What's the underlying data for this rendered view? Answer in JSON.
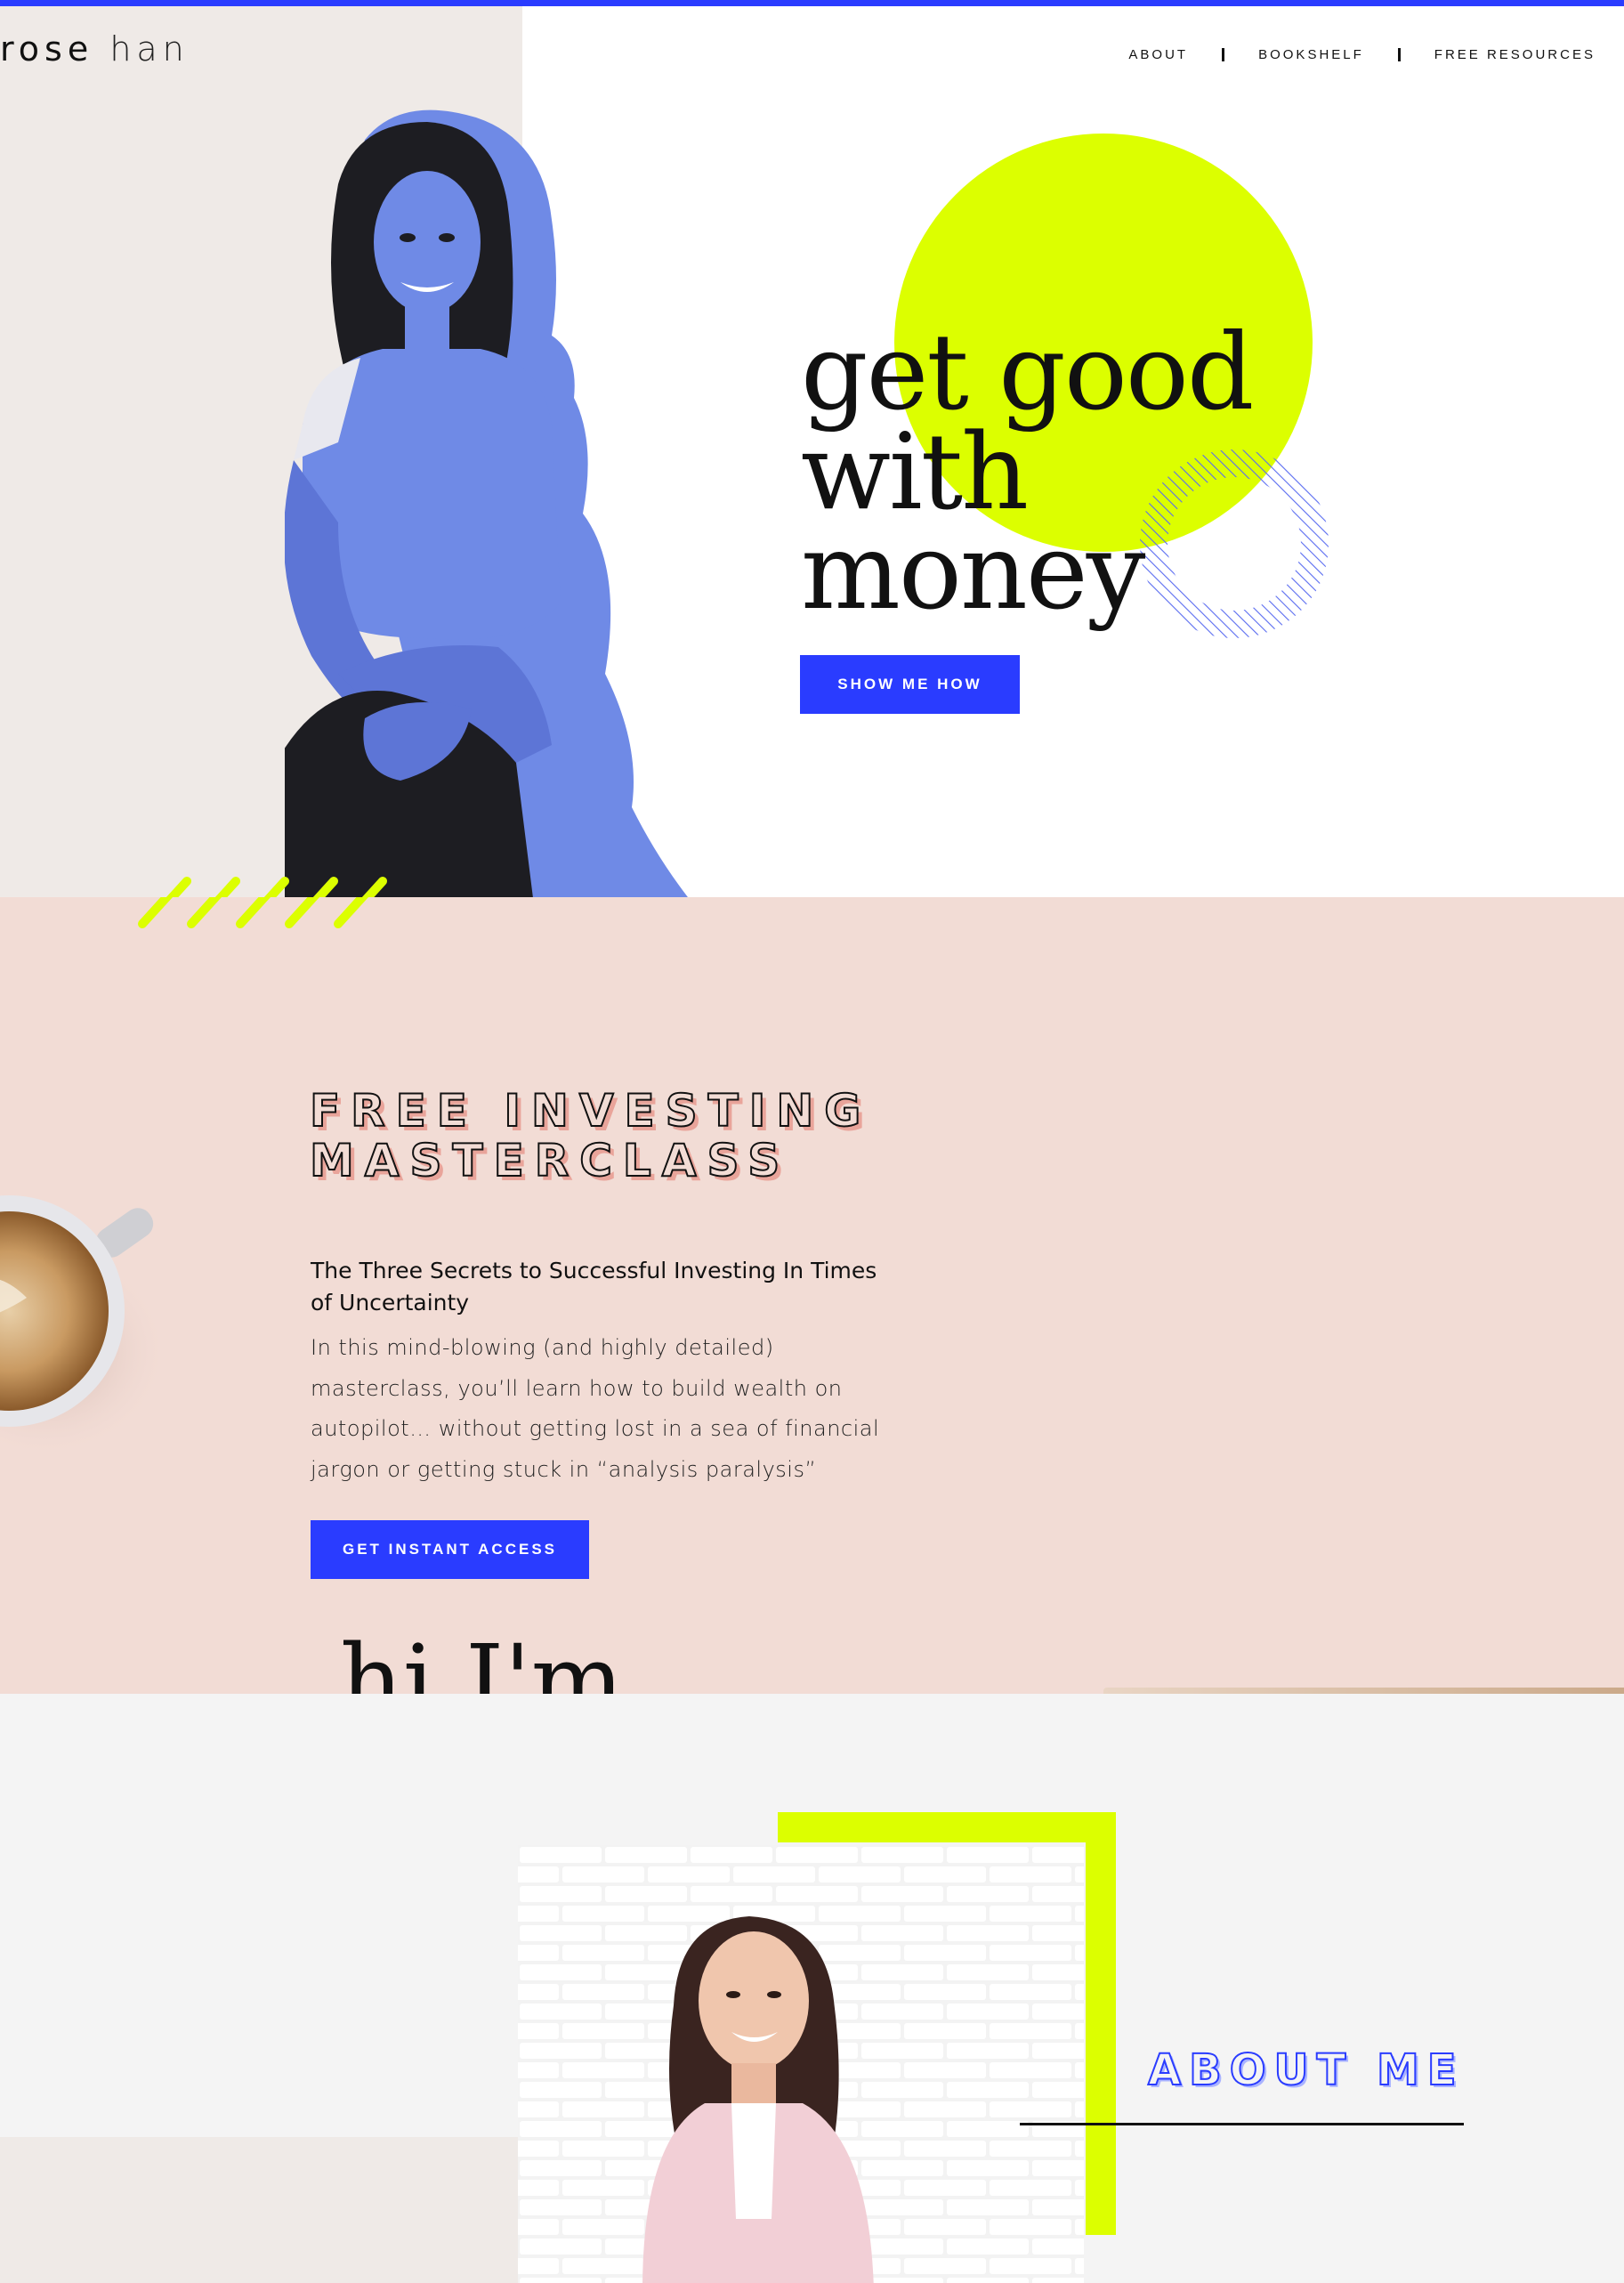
{
  "header": {
    "logo_first": "rose",
    "logo_last": "han",
    "nav": [
      "ABOUT",
      "BOOKSHELF",
      "FREE RESOURCES"
    ]
  },
  "hero": {
    "headline": [
      "get good",
      "with",
      "money"
    ],
    "cta": "SHOW ME HOW"
  },
  "masterclass": {
    "title_lines": [
      "FREE INVESTING",
      "MASTERCLASS"
    ],
    "subtitle": "The Three Secrets to Successful Investing In Times of Uncertainty",
    "body": "In this mind-blowing (and highly detailed) masterclass, you’ll learn how to build wealth on autopilot… without getting lost in a sea of financial jargon or getting stuck in “analysis paralysis”",
    "cta": "GET INSTANT ACCESS",
    "greeting": "hi I'm"
  },
  "about": {
    "title": "ABOUT ME"
  },
  "colors": {
    "accent_blue": "#2a3cff",
    "lime": "#dcff00",
    "pink_bg": "#f2dcd5",
    "beige": "#efeae7",
    "portrait_blue": "#6f8ae6"
  },
  "icons": [
    "diagonal-stripes-icon",
    "striped-ring-icon"
  ]
}
